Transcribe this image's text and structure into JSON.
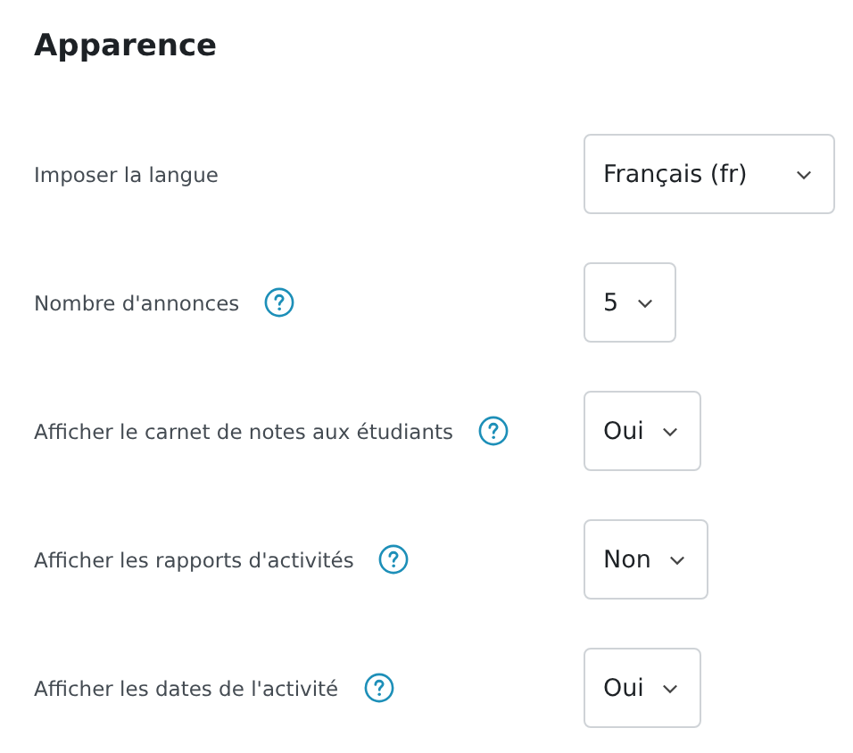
{
  "title": "Apparence",
  "settings": [
    {
      "label": "Imposer la langue",
      "help": false,
      "value": "Français (fr)"
    },
    {
      "label": "Nombre d'annonces",
      "help": true,
      "value": "5"
    },
    {
      "label": "Afficher le carnet de notes aux étudiants",
      "help": true,
      "value": "Oui"
    },
    {
      "label": "Afficher les rapports d'activités",
      "help": true,
      "value": "Non"
    },
    {
      "label": "Afficher les dates de l'activité",
      "help": true,
      "value": "Oui"
    }
  ]
}
